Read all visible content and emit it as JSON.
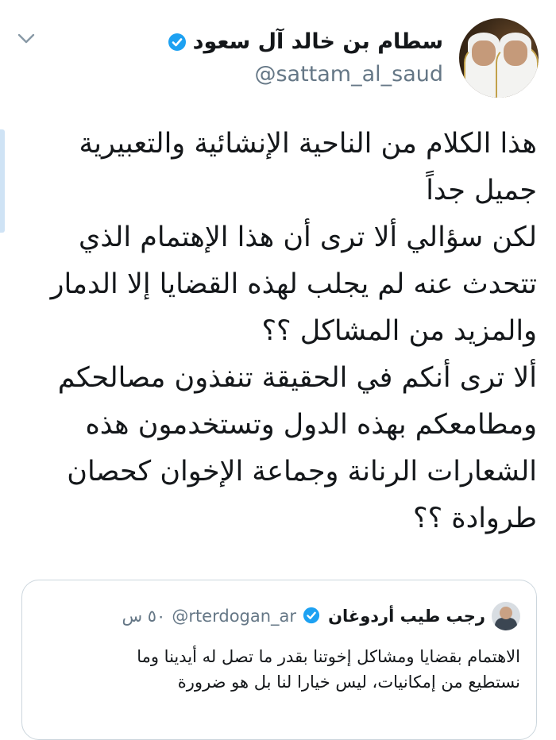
{
  "tweet": {
    "display_name": "سطام بن خالد آل سعود",
    "handle": "@sattam_al_saud",
    "avatar": "profile-photo-icon",
    "verified": "verified-badge-icon",
    "menu": "chevron-down-icon",
    "text_lines": [
      "هذا الكلام من الناحية الإنشائية والتعبيرية",
      "جميل جداً",
      "لكن سؤالي ألا ترى أن هذا الإهتمام الذي",
      "تتحدث عنه لم يجلب لهذه القضايا إلا الدمار",
      "والمزيد من المشاكل ؟؟",
      "ألا ترى أنكم في الحقيقة تنفذون مصالحكم",
      "ومطامعكم بهذه الدول وتستخدمون هذه",
      "الشعارات الرنانة وجماعة الإخوان كحصان",
      "طروادة ؟؟"
    ]
  },
  "quote": {
    "display_name": "رجب طيب أردوغان",
    "handle": "@rterdogan_ar",
    "time": "٥٠ س",
    "text_lines": [
      "الاهتمام بقضايا ومشاكل إخوتنا بقدر ما تصل له أيدينا وما",
      "نستطيع من إمكانيات، ليس خيارا لنا بل هو ضرورة"
    ]
  },
  "colors": {
    "primary_text": "#14171a",
    "secondary_text": "#657786",
    "verified_blue": "#1da1f2",
    "border": "#ccd6dd"
  }
}
